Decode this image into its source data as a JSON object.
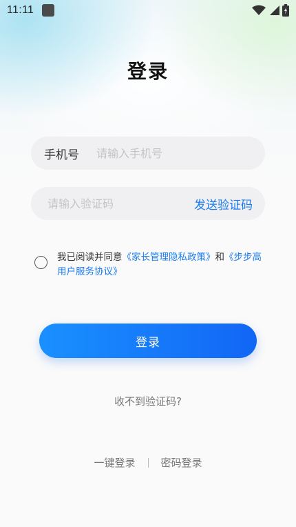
{
  "status_bar": {
    "time": "11:11",
    "icons": [
      "app-notification-icon",
      "wifi-icon",
      "cellular-signal-icon",
      "battery-charging-icon"
    ]
  },
  "title": "登录",
  "phone": {
    "label": "手机号",
    "placeholder": "请输入手机号"
  },
  "code": {
    "placeholder": "请输入验证码",
    "send_label": "发送验证码"
  },
  "agreement": {
    "prefix": "我已阅读并同意",
    "policy_link": "《家长管理隐私政策》",
    "conjunction": "和",
    "service_link": "《步步高用户服务协议》",
    "checked": false
  },
  "login_button": "登录",
  "no_code_link": "收不到验证码?",
  "alt_login": {
    "one_tap": "一键登录",
    "password": "密码登录"
  },
  "colors": {
    "accent": "#1a7cf0",
    "button_start": "#1a90ff",
    "button_end": "#1266f5",
    "field_bg": "#f0f0f2"
  }
}
